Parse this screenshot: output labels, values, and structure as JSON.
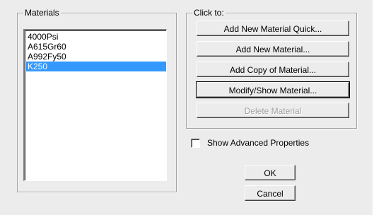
{
  "materials_group": {
    "legend": "Materials",
    "items": [
      "4000Psi",
      "A615Gr60",
      "A992Fy50",
      "K250"
    ],
    "selected_index": 3
  },
  "clickto_group": {
    "legend": "Click to:",
    "buttons": [
      {
        "label": "Add New Material Quick...",
        "enabled": true
      },
      {
        "label": "Add New Material...",
        "enabled": true
      },
      {
        "label": "Add Copy of Material...",
        "enabled": true
      },
      {
        "label": "Modify/Show Material...",
        "enabled": true
      },
      {
        "label": "Delete Material",
        "enabled": false
      }
    ]
  },
  "advanced": {
    "label": "Show Advanced Properties",
    "checked": false
  },
  "ok_label": "OK",
  "cancel_label": "Cancel"
}
